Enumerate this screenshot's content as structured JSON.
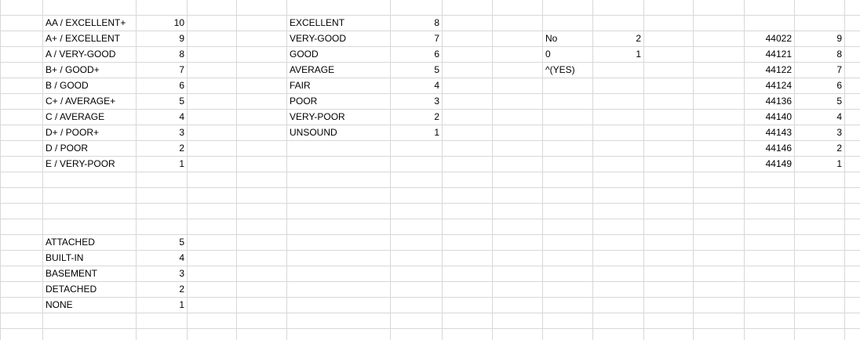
{
  "sheet": {
    "grade_scale": [
      {
        "label": "AA / EXCELLENT+",
        "value": "10"
      },
      {
        "label": "A+ / EXCELLENT",
        "value": "9"
      },
      {
        "label": "A / VERY-GOOD",
        "value": "8"
      },
      {
        "label": "B+ / GOOD+",
        "value": "7"
      },
      {
        "label": "B / GOOD",
        "value": "6"
      },
      {
        "label": "C+ / AVERAGE+",
        "value": "5"
      },
      {
        "label": "C / AVERAGE",
        "value": "4"
      },
      {
        "label": "D+ / POOR+",
        "value": "3"
      },
      {
        "label": "D / POOR",
        "value": "2"
      },
      {
        "label": "E / VERY-POOR",
        "value": "1"
      }
    ],
    "condition_scale": [
      {
        "label": "EXCELLENT",
        "value": "8"
      },
      {
        "label": "VERY-GOOD",
        "value": "7"
      },
      {
        "label": "GOOD",
        "value": "6"
      },
      {
        "label": "AVERAGE",
        "value": "5"
      },
      {
        "label": "FAIR",
        "value": "4"
      },
      {
        "label": "POOR",
        "value": "3"
      },
      {
        "label": "VERY-POOR",
        "value": "2"
      },
      {
        "label": "UNSOUND",
        "value": "1"
      }
    ],
    "yes_no": [
      {
        "label": "No",
        "value": "2"
      },
      {
        "label": "0",
        "value": "1"
      },
      {
        "label": "^(YES)",
        "value": ""
      }
    ],
    "date_scale": [
      {
        "label": "44022",
        "value": "9"
      },
      {
        "label": "44121",
        "value": "8"
      },
      {
        "label": "44122",
        "value": "7"
      },
      {
        "label": "44124",
        "value": "6"
      },
      {
        "label": "44136",
        "value": "5"
      },
      {
        "label": "44140",
        "value": "4"
      },
      {
        "label": "44143",
        "value": "3"
      },
      {
        "label": "44146",
        "value": "2"
      },
      {
        "label": "44149",
        "value": "1"
      }
    ],
    "garage_scale": [
      {
        "label": "ATTACHED",
        "value": "5"
      },
      {
        "label": "BUILT-IN",
        "value": "4"
      },
      {
        "label": "BASEMENT",
        "value": "3"
      },
      {
        "label": "DETACHED",
        "value": "2"
      },
      {
        "label": "NONE",
        "value": "1"
      }
    ]
  }
}
